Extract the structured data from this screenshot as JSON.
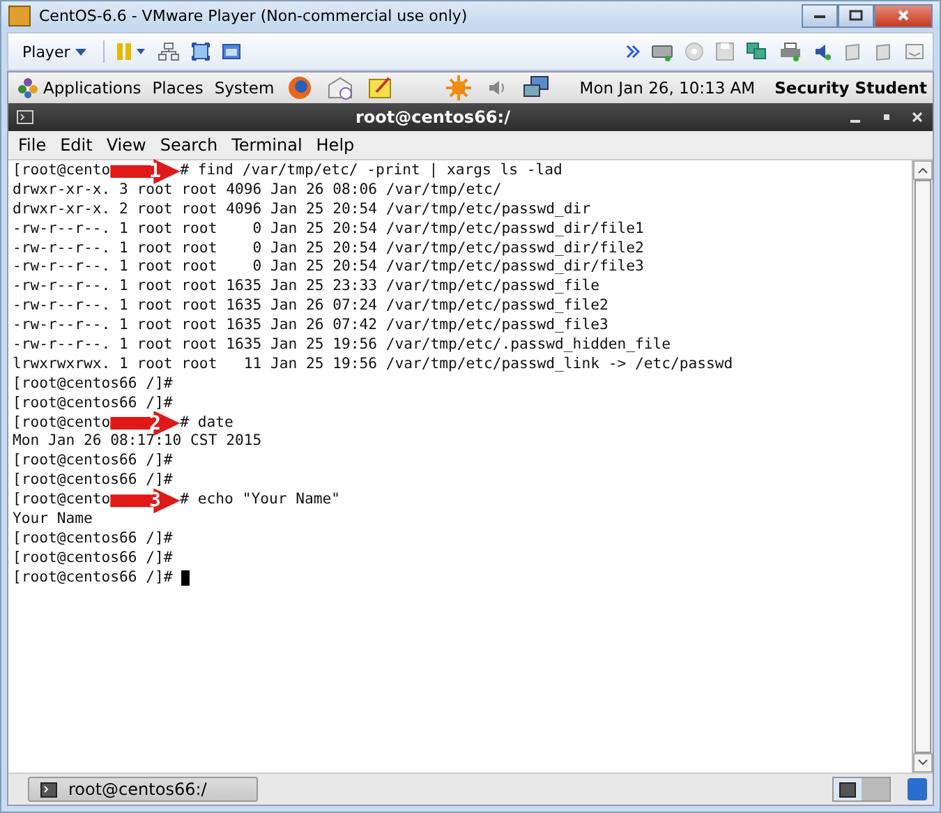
{
  "vm_window": {
    "title": "CentOS-6.6 - VMware Player (Non-commercial use only)"
  },
  "vm_toolbar": {
    "player_menu": "Player"
  },
  "panel": {
    "menus": [
      "Applications",
      "Places",
      "System"
    ],
    "clock": "Mon Jan 26, 10:13 AM",
    "user": "Security Student"
  },
  "terminal": {
    "title": "root@centos66:/",
    "menu": [
      "File",
      "Edit",
      "View",
      "Search",
      "Terminal",
      "Help"
    ],
    "lines": [
      {
        "kind": "callout",
        "before": "[root@cento",
        "badge": "1",
        "after": "# find /var/tmp/etc/ -print | xargs ls -lad"
      },
      {
        "kind": "text",
        "text": "drwxr-xr-x. 3 root root 4096 Jan 26 08:06 /var/tmp/etc/"
      },
      {
        "kind": "text",
        "text": "drwxr-xr-x. 2 root root 4096 Jan 25 20:54 /var/tmp/etc/passwd_dir"
      },
      {
        "kind": "text",
        "text": "-rw-r--r--. 1 root root    0 Jan 25 20:54 /var/tmp/etc/passwd_dir/file1"
      },
      {
        "kind": "text",
        "text": "-rw-r--r--. 1 root root    0 Jan 25 20:54 /var/tmp/etc/passwd_dir/file2"
      },
      {
        "kind": "text",
        "text": "-rw-r--r--. 1 root root    0 Jan 25 20:54 /var/tmp/etc/passwd_dir/file3"
      },
      {
        "kind": "text",
        "text": "-rw-r--r--. 1 root root 1635 Jan 25 23:33 /var/tmp/etc/passwd_file"
      },
      {
        "kind": "text",
        "text": "-rw-r--r--. 1 root root 1635 Jan 26 07:24 /var/tmp/etc/passwd_file2"
      },
      {
        "kind": "text",
        "text": "-rw-r--r--. 1 root root 1635 Jan 26 07:42 /var/tmp/etc/passwd_file3"
      },
      {
        "kind": "text",
        "text": "-rw-r--r--. 1 root root 1635 Jan 25 19:56 /var/tmp/etc/.passwd_hidden_file"
      },
      {
        "kind": "text",
        "text": "lrwxrwxrwx. 1 root root   11 Jan 25 19:56 /var/tmp/etc/passwd_link -> /etc/passwd"
      },
      {
        "kind": "text",
        "text": "[root@centos66 /]#"
      },
      {
        "kind": "text",
        "text": "[root@centos66 /]#"
      },
      {
        "kind": "callout",
        "before": "[root@cento",
        "badge": "2",
        "after": "# date"
      },
      {
        "kind": "text",
        "text": "Mon Jan 26 08:17:10 CST 2015"
      },
      {
        "kind": "text",
        "text": "[root@centos66 /]#"
      },
      {
        "kind": "text",
        "text": "[root@centos66 /]#"
      },
      {
        "kind": "callout",
        "before": "[root@cento",
        "badge": "3",
        "after": "# echo \"Your Name\""
      },
      {
        "kind": "text",
        "text": "Your Name"
      },
      {
        "kind": "text",
        "text": "[root@centos66 /]#"
      },
      {
        "kind": "text",
        "text": "[root@centos66 /]#"
      },
      {
        "kind": "cursor",
        "text": "[root@centos66 /]#"
      }
    ]
  },
  "taskbar": {
    "task": "root@centos66:/"
  }
}
